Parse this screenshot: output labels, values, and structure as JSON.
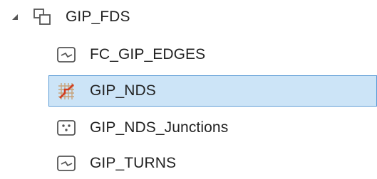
{
  "tree": {
    "root": {
      "label": "GIP_FDS",
      "icon": "feature-dataset-icon",
      "expanded": true
    },
    "children": [
      {
        "label": "FC_GIP_EDGES",
        "icon": "line-feature-class-icon",
        "selected": false
      },
      {
        "label": "GIP_NDS",
        "icon": "network-dataset-icon",
        "selected": true
      },
      {
        "label": "GIP_NDS_Junctions",
        "icon": "point-feature-class-icon",
        "selected": false
      },
      {
        "label": "GIP_TURNS",
        "icon": "line-feature-class-icon",
        "selected": false
      }
    ]
  },
  "colors": {
    "selection_background": "#cce4f7",
    "selection_border": "#5b9bd5",
    "icon_stroke": "#555555",
    "network_grid": "#c7a27a",
    "network_edge": "#d23b1f"
  }
}
